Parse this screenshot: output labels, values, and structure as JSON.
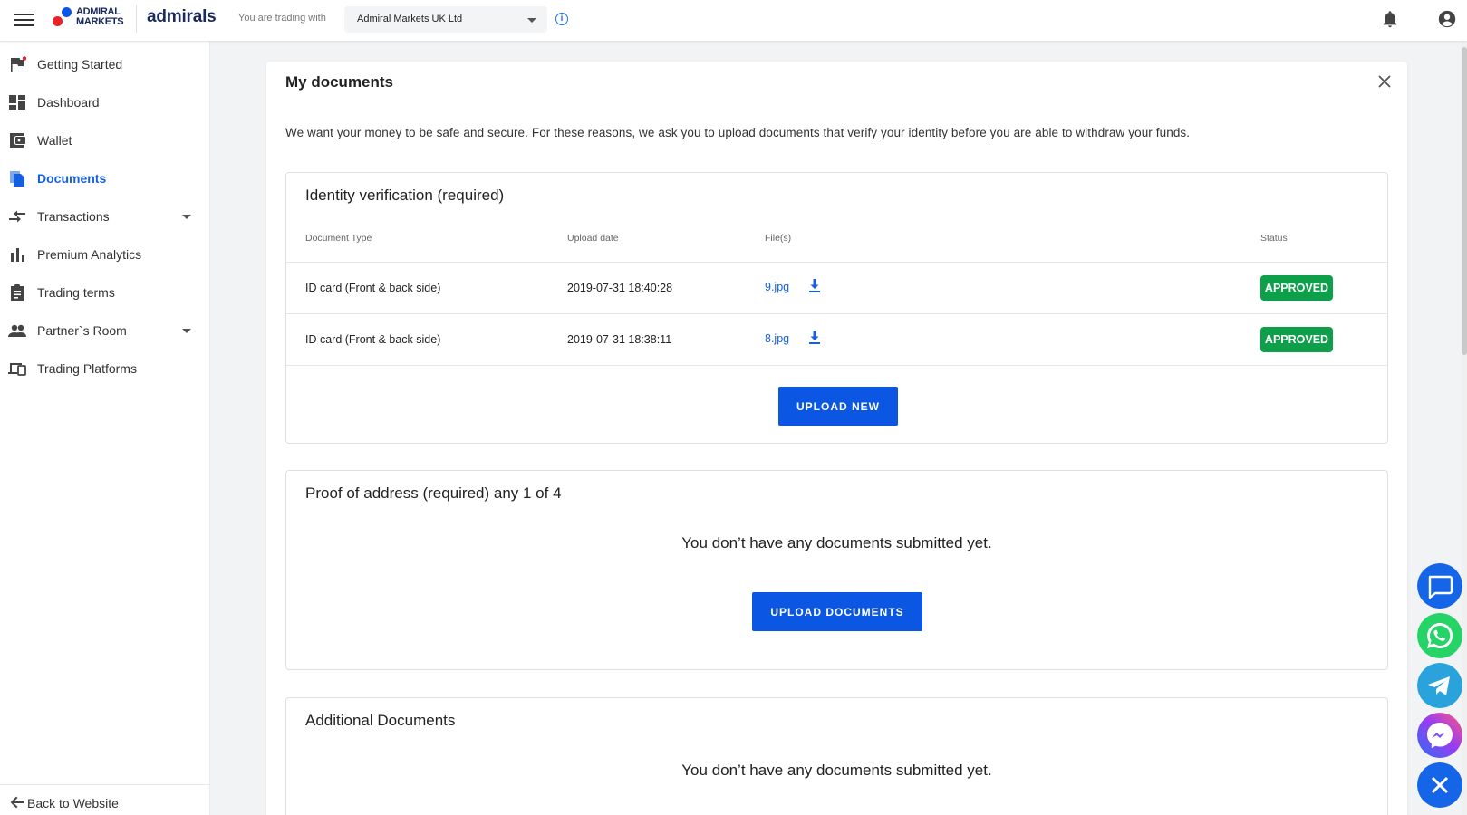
{
  "header": {
    "logo_line1": "ADMIRAL",
    "logo_line2": "MARKETS",
    "brand": "admirals",
    "trading_with_label": "You are trading with",
    "entity_selected": "Admiral Markets UK Ltd"
  },
  "sidebar": {
    "items": [
      {
        "label": "Getting Started"
      },
      {
        "label": "Dashboard"
      },
      {
        "label": "Wallet"
      },
      {
        "label": "Documents"
      },
      {
        "label": "Transactions"
      },
      {
        "label": "Premium Analytics"
      },
      {
        "label": "Trading terms"
      },
      {
        "label": "Partner`s Room"
      },
      {
        "label": "Trading Platforms"
      }
    ],
    "back_label": "Back to Website"
  },
  "main": {
    "title": "My documents",
    "intro": "We want your money to be safe and secure. For these reasons, we ask you to upload documents that verify your identity before you are able to withdraw your funds.",
    "identity": {
      "title": "Identity verification (required)",
      "columns": [
        "Document Type",
        "Upload date",
        "File(s)",
        "Status"
      ],
      "rows": [
        {
          "type": "ID card (Front & back side)",
          "date": "2019-07-31 18:40:28",
          "file": "9.jpg",
          "status": "APPROVED"
        },
        {
          "type": "ID card (Front & back side)",
          "date": "2019-07-31 18:38:11",
          "file": "8.jpg",
          "status": "APPROVED"
        }
      ],
      "upload_label": "UPLOAD NEW"
    },
    "address": {
      "title": "Proof of address (required) any 1 of 4",
      "empty": "You don’t have any documents submitted yet.",
      "upload_label": "UPLOAD DOCUMENTS"
    },
    "additional": {
      "title": "Additional Documents",
      "empty": "You don’t have any documents submitted yet."
    }
  },
  "colors": {
    "accent": "#0b57e3",
    "approved": "#0e9f4a",
    "whatsapp": "#25d366",
    "telegram": "#2aa3dd"
  }
}
